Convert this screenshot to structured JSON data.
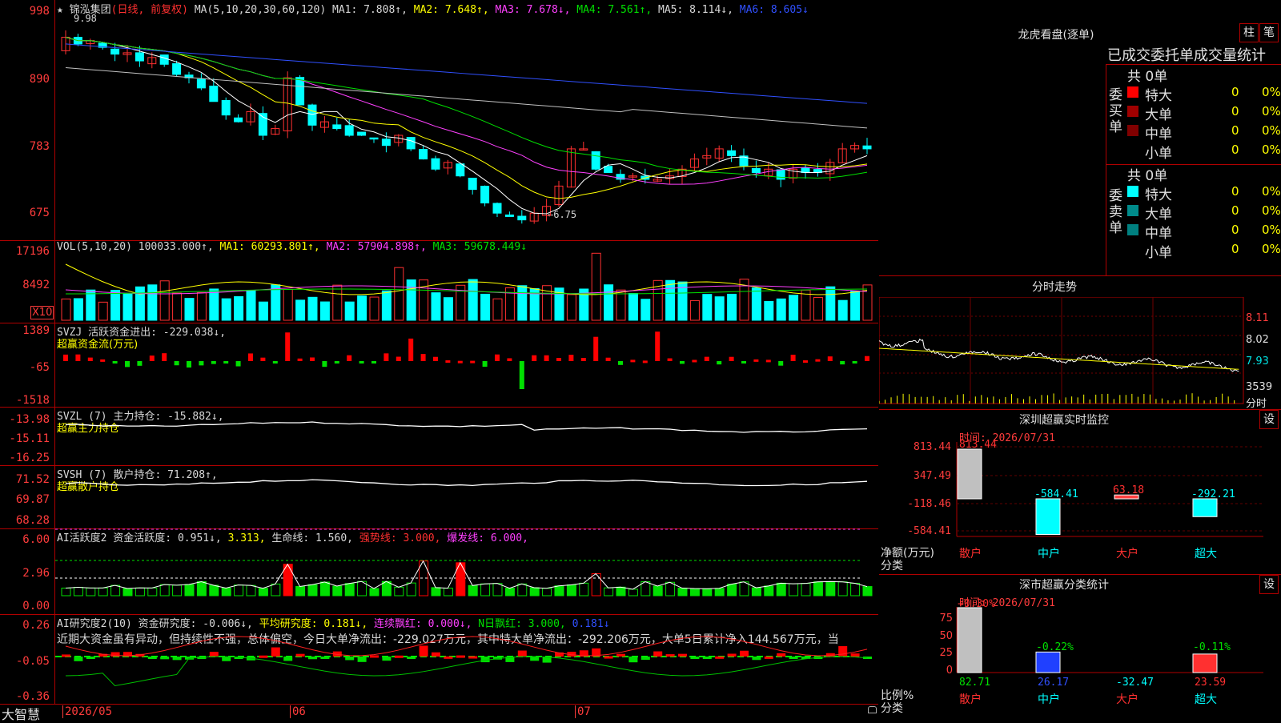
{
  "main": {
    "star": "★",
    "name": "锦泓集团",
    "mode": "(日线, 前复权)",
    "ma_label": "MA(5,10,20,30,60,120)",
    "ma1": "MA1: 7.808↑,",
    "ma2": "MA2: 7.648↑,",
    "ma3": "MA3: 7.678↓,",
    "ma4": "MA4: 7.561↑,",
    "ma5": "MA5: 8.114↓,",
    "ma6": "MA6: 8.605↓",
    "y_ticks": [
      "998",
      "890",
      "783",
      "675"
    ],
    "high_mark": "9.98",
    "low_mark": "←6.75"
  },
  "vol": {
    "label": "VOL(5,10,20)",
    "value": "100033.000↑,",
    "ma1": "MA1: 60293.801↑,",
    "ma2": "MA2: 57904.898↑,",
    "ma3": "MA3: 59678.449↓",
    "y_ticks": [
      "17196",
      "8492"
    ],
    "unit": "X10"
  },
  "svzj": {
    "label": "SVZJ  活跃资金进出: -229.038↓,",
    "sub": "超赢资金流(万元)",
    "y_ticks": [
      "1389",
      "-65",
      "-1518"
    ]
  },
  "svzl": {
    "label": "SVZL (7) 主力持仓: -15.882↓,",
    "sub": "超赢主力持仓",
    "y_ticks": [
      "-13.98",
      "-15.11",
      "-16.25"
    ]
  },
  "svsh": {
    "label": "SVSH (7) 散户持仓: 71.208↑,",
    "sub": "超赢散户持仓",
    "y_ticks": [
      "71.52",
      "69.87",
      "68.28"
    ]
  },
  "ai1": {
    "label": "AI活跃度2 资金活跃度: 0.951↓,",
    "v2": "3.313,",
    "v3": "生命线: 1.560,",
    "v4": "强势线: 3.000,",
    "v5": "爆发线: 6.000,",
    "y_ticks": [
      "6.00",
      "2.96",
      "0.00"
    ]
  },
  "ai2": {
    "label": "AI研究度2(10) 资金研究度: -0.006↓,",
    "v2": "平均研究度: 0.181↓,",
    "v3": "连续飘红: 0.000↓,",
    "v4": "N日飘红: 3.000,",
    "v5": "0.181↓",
    "text": "近期大资金虽有异动，但持续性不强，总体偏空，今日大单净流出：-229.027万元，其中特大单净流出：-292.206万元，大单5日累计净入144.567万元，当",
    "y_ticks": [
      "0.26",
      "-0.05",
      "-0.36"
    ]
  },
  "xaxis": {
    "brand": "大智慧",
    "labels": [
      "2026/05",
      "06",
      "07"
    ]
  },
  "right": {
    "lh_title": "龙虎看盘(逐单)",
    "btn1": "柱",
    "btn2": "笔",
    "table_title": "已成交委托单成交量统计",
    "buy_label": "委买单",
    "sell_label": "委卖单",
    "buy_total": "共 0单",
    "sell_total": "共 0单",
    "rows": [
      "特大",
      "大单",
      "中单",
      "小单"
    ],
    "zero": "0",
    "pct": "0%",
    "colors": {
      "buy": [
        "#ff0000",
        "#a00000",
        "#800000",
        "#000000"
      ],
      "sell": [
        "#00ffff",
        "#008b8b",
        "#008080",
        "#000000"
      ]
    },
    "fs_title": "分时走势",
    "fs_ticks": [
      "8.11",
      "8.02",
      "7.93"
    ],
    "fs_vol": "3539",
    "fs_unit": "分时",
    "sz_title": "深圳超赢实时监控",
    "sz_date": "时间: 2026/07/31",
    "set": "设",
    "sz_ticks": [
      "813.44",
      "347.49",
      "-118.46",
      "-584.41"
    ],
    "sz_vals": [
      "813.44",
      "-584.41",
      "63.18",
      "-292.21"
    ],
    "sz_axis1": "净额(万元)",
    "sz_axis2": "分类",
    "cats": [
      "散户",
      "中户",
      "大户",
      "超大"
    ],
    "sm_title": "深市超赢分类统计",
    "sm_date": "时间: 2026/07/31",
    "sm_ticks": [
      "75",
      "50",
      "25",
      "0"
    ],
    "sm_pcts": [
      "+0.30%",
      "-0.22%",
      "-0.11%"
    ],
    "sm_vals": [
      "82.71",
      "26.17",
      "-32.47",
      "23.59"
    ],
    "sm_axis1": "比例%",
    "sm_axis2": "分类"
  }
}
